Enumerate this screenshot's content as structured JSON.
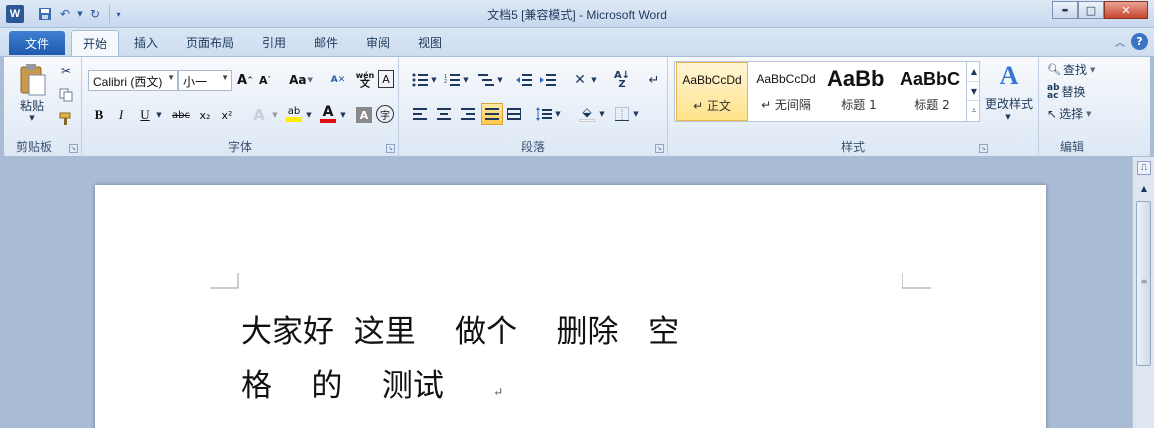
{
  "titlebar": {
    "app_icon_letter": "W",
    "title": "文档5 [兼容模式] - Microsoft Word",
    "minimize": "▬",
    "maximize": "□",
    "close": "✕"
  },
  "tabs": {
    "file": "文件",
    "items": [
      "开始",
      "插入",
      "页面布局",
      "引用",
      "邮件",
      "审阅",
      "视图"
    ]
  },
  "clipboard": {
    "paste_label": "粘贴",
    "group_label": "剪贴板"
  },
  "font": {
    "font_name": "Calibri (西文)",
    "font_size": "小一",
    "group_label": "字体",
    "change_case": "Aa",
    "bold": "B",
    "italic": "I",
    "underline": "U",
    "strikethrough": "abc",
    "subscript": "x₂",
    "superscript": "x²",
    "highlight": "ab",
    "font_color": "A",
    "char_shading": "A",
    "enclose": "字",
    "grow": "A",
    "shrink": "A",
    "phonetic": "wén",
    "char_border": "A"
  },
  "paragraph": {
    "group_label": "段落"
  },
  "styles": {
    "group_label": "样式",
    "items": [
      {
        "preview": "AaBbCcDd",
        "name": "↵ 正文"
      },
      {
        "preview": "AaBbCcDd",
        "name": "↵ 无间隔"
      },
      {
        "preview": "AaBb",
        "name": "标题 1"
      },
      {
        "preview": "AaBbC",
        "name": "标题 2"
      }
    ],
    "change_styles": "更改样式"
  },
  "editing": {
    "group_label": "编辑",
    "find": "查找",
    "replace": "替换",
    "select": "选择"
  },
  "document": {
    "line1": "大家好  这里    做个    删除   空",
    "line2": "格    的    测试     ",
    "pilcrow": "↵"
  }
}
